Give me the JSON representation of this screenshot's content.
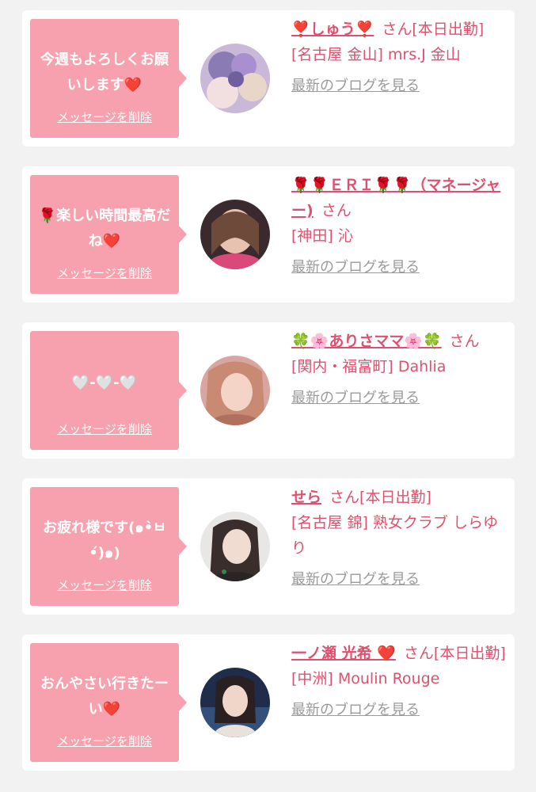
{
  "entries": [
    {
      "message": "今週もよろしくお願いします❤️",
      "delete_label": "メッセージを削除",
      "cast_name": "❣️しゅう❣️",
      "honorific": "さん",
      "status": "[本日出勤]",
      "shop": "[名古屋 金山] mrs.J 金山",
      "blog_label": "最新のブログを見る"
    },
    {
      "message": "🌹楽しい時間最高だね❤️",
      "delete_label": "メッセージを削除",
      "cast_name": "🌹🌹ＥＲＩ🌹🌹（マネージャー)",
      "honorific": "さん",
      "status": "",
      "shop": "[神田] 沁",
      "blog_label": "最新のブログを見る"
    },
    {
      "message": "🤍-🤍-🤍",
      "delete_label": "メッセージを削除",
      "cast_name": "🍀🌸ありさママ🌸🍀",
      "honorific": "さん",
      "status": "",
      "shop": "[関内・福富町] Dahlia",
      "blog_label": "最新のブログを見る"
    },
    {
      "message": "お疲れ様です(๑•̀ㅂ•́)๑)",
      "delete_label": "メッセージを削除",
      "cast_name": "せら",
      "honorific": "さん",
      "status": "[本日出勤]",
      "shop": "[名古屋 錦] 熟女クラブ しらゆり",
      "blog_label": "最新のブログを見る"
    },
    {
      "message": "おんやさい行きたーい❤️",
      "delete_label": "メッセージを削除",
      "cast_name": "一ノ瀬 光希 ❤️",
      "honorific": "さん",
      "status": "[本日出勤]",
      "shop": "[中洲] Moulin Rouge",
      "blog_label": "最新のブログを見る"
    }
  ]
}
